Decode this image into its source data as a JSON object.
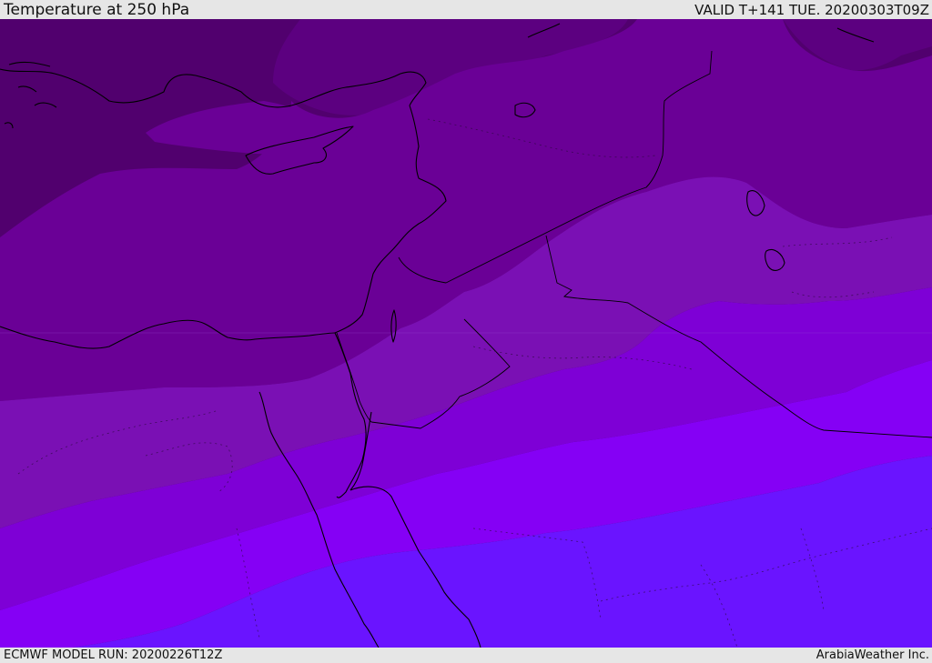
{
  "header": {
    "title": "Temperature at 250 hPa",
    "valid": "VALID T+141 TUE. 20200303T09Z"
  },
  "footer": {
    "model_run": "ECMWF MODEL RUN: 20200226T12Z",
    "credit": "ArabiaWeather Inc."
  },
  "map": {
    "field": "temperature-250hpa",
    "colors": {
      "band_darkest": "#51006e",
      "band_dark": "#5c0080",
      "band_mid_dark": "#6a0096",
      "band_mid": "#7a10b4",
      "band_violet": "#7e00d6",
      "band_bright": "#8500f5",
      "band_blue": "#6a14ff",
      "coast": "#000000"
    }
  }
}
